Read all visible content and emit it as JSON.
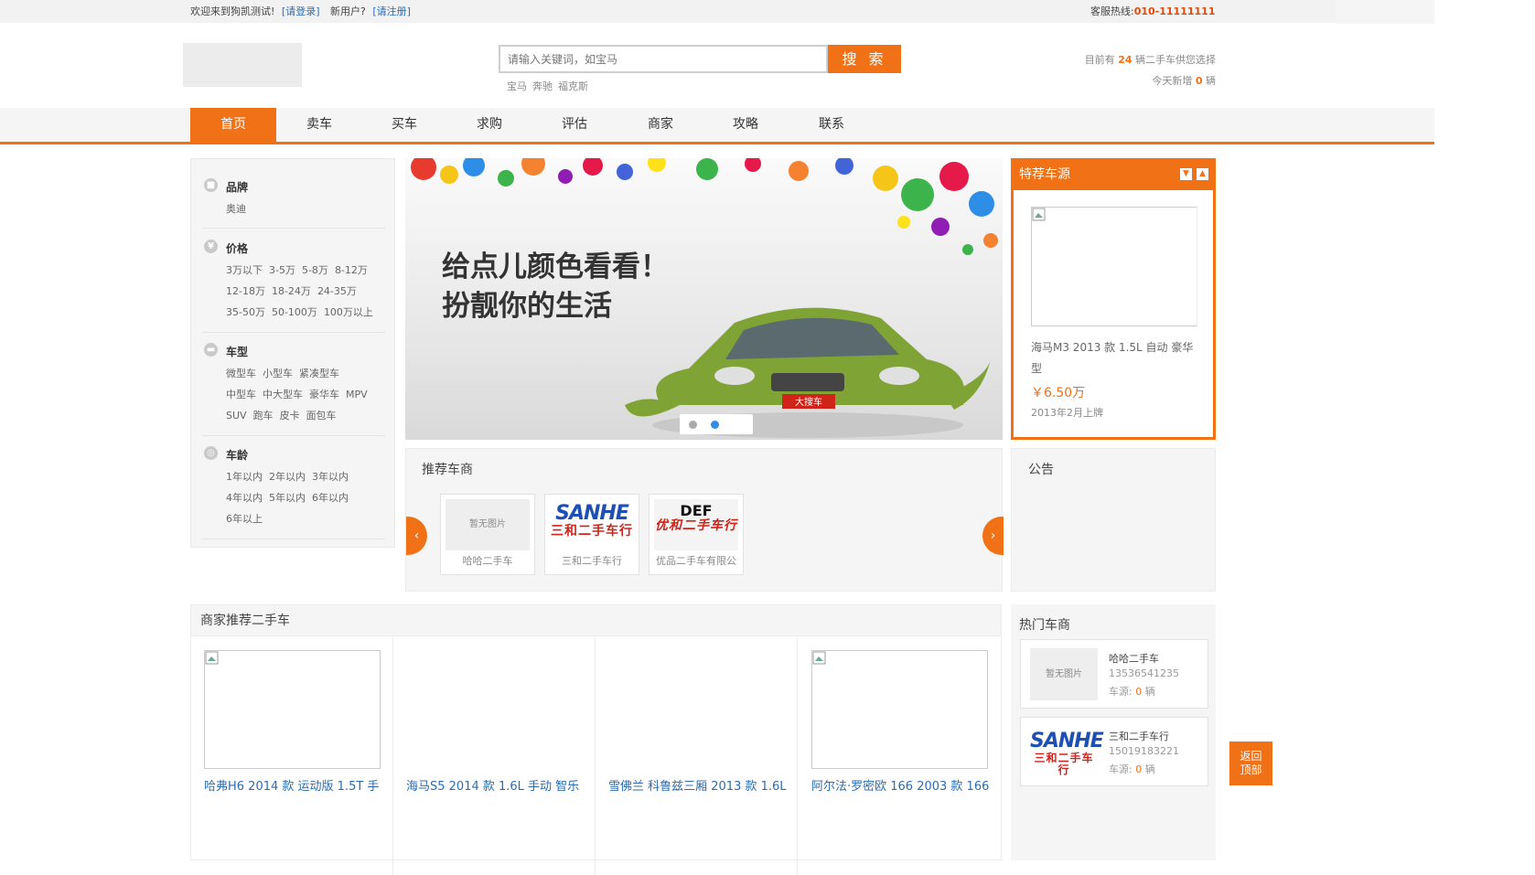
{
  "topbar": {
    "welcome": "欢迎来到狗凯测试!",
    "login": "[请登录]",
    "new_user": "新用户?",
    "register": "[请注册]",
    "hotline_label": "客服热线:",
    "hotline": "010-11111111"
  },
  "search": {
    "placeholder": "请输入关键词，如宝马",
    "button": "搜 索",
    "hot": [
      "宝马",
      "奔驰",
      "福克斯"
    ]
  },
  "stats": {
    "line1_pre": "目前有 ",
    "count": "24",
    "line1_post": " 辆二手车供您选择",
    "line2_pre": "今天新增 ",
    "today": "0",
    "line2_post": " 辆"
  },
  "nav": [
    "首页",
    "卖车",
    "买车",
    "求购",
    "评估",
    "商家",
    "攻略",
    "联系"
  ],
  "filters": {
    "brand": {
      "title": "品牌",
      "rows": [
        [
          "奥迪"
        ]
      ]
    },
    "price": {
      "title": "价格",
      "rows": [
        [
          "3万以下",
          "3-5万",
          "5-8万",
          "8-12万"
        ],
        [
          "12-18万",
          "18-24万",
          "24-35万"
        ],
        [
          "35-50万",
          "50-100万",
          "100万以上"
        ]
      ]
    },
    "type": {
      "title": "车型",
      "rows": [
        [
          "微型车",
          "小型车",
          "紧凑型车"
        ],
        [
          "中型车",
          "中大型车",
          "豪华车",
          "MPV"
        ],
        [
          "SUV",
          "跑车",
          "皮卡",
          "面包车"
        ]
      ]
    },
    "age": {
      "title": "车龄",
      "rows": [
        [
          "1年以内",
          "2年以内",
          "3年以内"
        ],
        [
          "4年以内",
          "5年以内",
          "6年以内"
        ],
        [
          "6年以上"
        ]
      ]
    }
  },
  "banner": {
    "line1": "给点儿颜色看看！",
    "line2": "扮靓你的生活",
    "plate": "大搜车"
  },
  "featured": {
    "title": "特荐车源",
    "car_title": "海马M3 2013 款 1.5L 自动 豪华型",
    "price": "￥6.50万",
    "date": "2013年2月上牌"
  },
  "recommended_dealers": {
    "title": "推荐车商",
    "items": [
      {
        "name": "哈哈二手车",
        "pic": "暂无图片"
      },
      {
        "name": "三和二手车行",
        "logo1": "SANHE",
        "logo2": "三和二手车行"
      },
      {
        "name": "优品二手车有限公",
        "logo1": "DEF",
        "logo2": "优和二手车行"
      }
    ]
  },
  "notice": {
    "title": "公告"
  },
  "dealer_cars": {
    "title": "商家推荐二手车",
    "items": [
      "哈弗H6 2014 款 运动版 1.5T 手",
      "海马S5 2014 款 1.6L 手动 智乐",
      "雪佛兰 科鲁兹三厢 2013 款 1.6L",
      "阿尔法·罗密欧 166 2003 款 166"
    ]
  },
  "hot_dealers": {
    "title": "热门车商",
    "items": [
      {
        "name": "哈哈二手车",
        "phone": "13536541235",
        "src_label": "车源: ",
        "src": "0",
        "unit": " 辆",
        "pic": "暂无图片"
      },
      {
        "name": "三和二手车行",
        "phone": "15019183221",
        "src_label": "车源: ",
        "src": "0",
        "unit": " 辆",
        "logo1": "SANHE",
        "logo2": "三和二手车行"
      }
    ]
  },
  "backtop": {
    "l1": "返回",
    "l2": "顶部"
  },
  "colors": {
    "accent": "#f07116",
    "link": "#2b6cb0"
  }
}
